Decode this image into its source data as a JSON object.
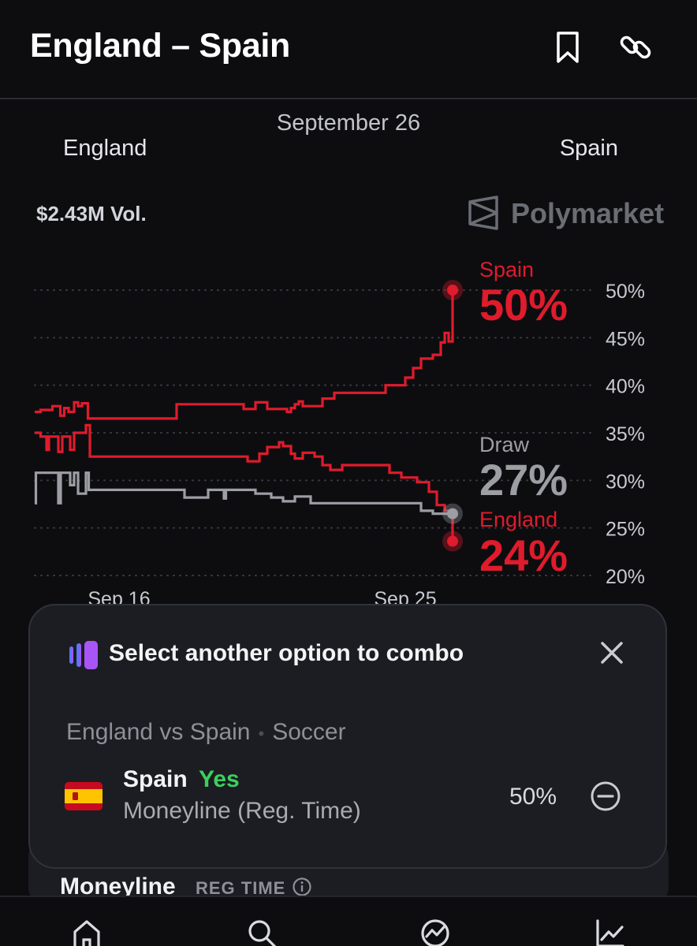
{
  "header": {
    "title": "England – Spain",
    "bookmark_icon": "bookmark-icon",
    "link_icon": "link-icon"
  },
  "match": {
    "date": "September 26",
    "team_left": "England",
    "team_right": "Spain",
    "volume": "$2.43M Vol.",
    "brand": "Polymarket"
  },
  "chart_data": {
    "type": "line",
    "x_ticks": [
      "Sep 16",
      "Sep 25"
    ],
    "y_ticks": [
      "50%",
      "45%",
      "40%",
      "35%",
      "30%",
      "25%",
      "20%"
    ],
    "ylim": [
      20,
      52
    ],
    "x_range": [
      0,
      100
    ],
    "grid": "dotted horizontal",
    "series": [
      {
        "name": "Spain",
        "label": "Spain",
        "value_label": "50%",
        "color": "#e01b2c",
        "points": [
          [
            0,
            37.2
          ],
          [
            1.5,
            37.2
          ],
          [
            1.5,
            37.4
          ],
          [
            4.5,
            37.4
          ],
          [
            4.5,
            37.8
          ],
          [
            6.5,
            37.8
          ],
          [
            6.5,
            36.8
          ],
          [
            7.5,
            36.8
          ],
          [
            7.5,
            37.6
          ],
          [
            8.6,
            37.6
          ],
          [
            8.6,
            37.2
          ],
          [
            10,
            37.2
          ],
          [
            10,
            38.2
          ],
          [
            11,
            38.2
          ],
          [
            11,
            37.8
          ],
          [
            12,
            37.8
          ],
          [
            12,
            38.1
          ],
          [
            13.5,
            38.1
          ],
          [
            13.5,
            36.5
          ],
          [
            36,
            36.5
          ],
          [
            36,
            38.0
          ],
          [
            53,
            38.0
          ],
          [
            53,
            37.5
          ],
          [
            56,
            37.5
          ],
          [
            56,
            38.2
          ],
          [
            59,
            38.2
          ],
          [
            59,
            37.5
          ],
          [
            64,
            37.5
          ],
          [
            64,
            37.2
          ],
          [
            65,
            37.2
          ],
          [
            65,
            37.6
          ],
          [
            66,
            37.6
          ],
          [
            66,
            38.0
          ],
          [
            67,
            38.0
          ],
          [
            67,
            38.3
          ],
          [
            68,
            38.3
          ],
          [
            68,
            37.8
          ],
          [
            73,
            37.8
          ],
          [
            73,
            38.6
          ],
          [
            76,
            38.6
          ],
          [
            76,
            39.2
          ],
          [
            89,
            39.2
          ],
          [
            89,
            40.0
          ],
          [
            94,
            40.0
          ],
          [
            94,
            40.8
          ],
          [
            96,
            40.8
          ],
          [
            96,
            41.8
          ],
          [
            98,
            41.8
          ],
          [
            98,
            42.8
          ],
          [
            101,
            42.8
          ],
          [
            101,
            43.2
          ],
          [
            103,
            43.2
          ],
          [
            103,
            44.5
          ],
          [
            104,
            44.5
          ],
          [
            104,
            45.5
          ],
          [
            105,
            45.5
          ],
          [
            105,
            44.6
          ],
          [
            106,
            44.6
          ],
          [
            106,
            50.0
          ]
        ]
      },
      {
        "name": "England",
        "label": "England",
        "value_label": "24%",
        "color": "#e01b2c",
        "points": [
          [
            0,
            35.0
          ],
          [
            1.5,
            35.0
          ],
          [
            1.5,
            34.6
          ],
          [
            3,
            34.6
          ],
          [
            3,
            33.2
          ],
          [
            3.6,
            33.2
          ],
          [
            3.6,
            34.6
          ],
          [
            6,
            34.6
          ],
          [
            6,
            33.0
          ],
          [
            7,
            33.0
          ],
          [
            7,
            34.6
          ],
          [
            9,
            34.6
          ],
          [
            9,
            33.2
          ],
          [
            10,
            33.2
          ],
          [
            10,
            35.0
          ],
          [
            13,
            35.0
          ],
          [
            13,
            35.8
          ],
          [
            14,
            35.8
          ],
          [
            14,
            32.5
          ],
          [
            54,
            32.5
          ],
          [
            54,
            32.0
          ],
          [
            57,
            32.0
          ],
          [
            57,
            32.8
          ],
          [
            59,
            32.8
          ],
          [
            59,
            33.5
          ],
          [
            62,
            33.5
          ],
          [
            62,
            34.0
          ],
          [
            63,
            34.0
          ],
          [
            63,
            33.6
          ],
          [
            65,
            33.6
          ],
          [
            65,
            32.8
          ],
          [
            66,
            32.8
          ],
          [
            66,
            32.3
          ],
          [
            68,
            32.3
          ],
          [
            68,
            32.9
          ],
          [
            71,
            32.9
          ],
          [
            71,
            32.5
          ],
          [
            73,
            32.5
          ],
          [
            73,
            31.6
          ],
          [
            75,
            31.6
          ],
          [
            75,
            31.1
          ],
          [
            78,
            31.1
          ],
          [
            78,
            31.6
          ],
          [
            90,
            31.6
          ],
          [
            90,
            30.8
          ],
          [
            93,
            30.8
          ],
          [
            93,
            30.3
          ],
          [
            97,
            30.3
          ],
          [
            97,
            29.8
          ],
          [
            100,
            29.8
          ],
          [
            100,
            28.8
          ],
          [
            102,
            28.8
          ],
          [
            102,
            27.4
          ],
          [
            104,
            27.4
          ],
          [
            104,
            26.8
          ],
          [
            106,
            26.8
          ],
          [
            106,
            23.6
          ]
        ]
      },
      {
        "name": "Draw",
        "label": "Draw",
        "value_label": "27%",
        "color": "#9c9ea4",
        "points": [
          [
            0,
            27.6
          ],
          [
            0.3,
            27.6
          ],
          [
            0.3,
            30.8
          ],
          [
            6,
            30.8
          ],
          [
            6,
            27.6
          ],
          [
            6.6,
            27.6
          ],
          [
            6.6,
            30.8
          ],
          [
            9,
            30.8
          ],
          [
            9,
            29.5
          ],
          [
            10,
            29.5
          ],
          [
            10,
            30.8
          ],
          [
            11,
            30.8
          ],
          [
            11,
            28.6
          ],
          [
            13,
            28.6
          ],
          [
            13,
            30.8
          ],
          [
            13.7,
            30.8
          ],
          [
            13.7,
            29.0
          ],
          [
            38,
            29.0
          ],
          [
            38,
            28.2
          ],
          [
            44,
            28.2
          ],
          [
            44,
            29.0
          ],
          [
            48,
            29.0
          ],
          [
            48,
            28.1
          ],
          [
            48.5,
            28.1
          ],
          [
            48.5,
            29.0
          ],
          [
            56,
            29.0
          ],
          [
            56,
            28.6
          ],
          [
            60,
            28.6
          ],
          [
            60,
            28.2
          ],
          [
            63,
            28.2
          ],
          [
            63,
            27.8
          ],
          [
            66,
            27.8
          ],
          [
            66,
            28.3
          ],
          [
            70,
            28.3
          ],
          [
            70,
            27.6
          ],
          [
            98,
            27.6
          ],
          [
            98,
            26.8
          ],
          [
            101,
            26.8
          ],
          [
            101,
            26.5
          ],
          [
            106,
            26.5
          ]
        ]
      }
    ]
  },
  "combo": {
    "icon": "combo-icon",
    "title": "Select another option to combo",
    "close_icon": "close-icon",
    "event": "England vs Spain",
    "sport": "Soccer",
    "separator": "•",
    "pick_team": "Spain",
    "pick_side": "Yes",
    "market": "Moneyline (Reg. Time)",
    "pick_price": "50%",
    "flag_icon": "spain-flag-icon",
    "remove_icon": "remove-icon"
  },
  "section": {
    "title": "Moneyline",
    "badge": "REG TIME",
    "info_icon": "info-icon"
  },
  "nav": {
    "items": [
      "home-icon",
      "search-icon",
      "activity-icon",
      "chart-icon"
    ]
  }
}
